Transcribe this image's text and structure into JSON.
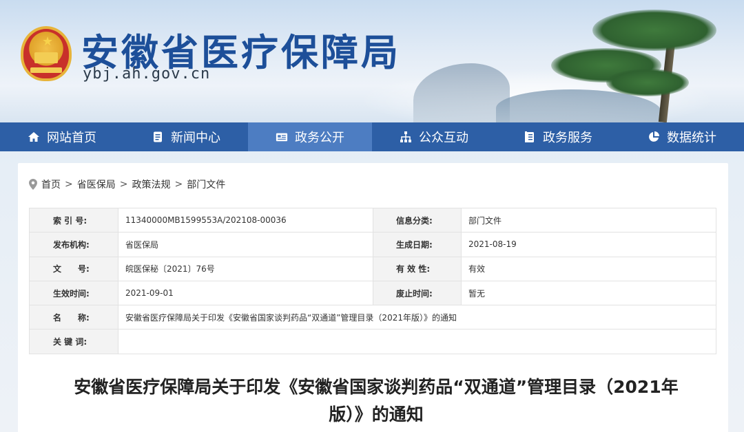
{
  "header": {
    "title": "安徽省医疗保障局",
    "url": "ybj.ah.gov.cn"
  },
  "nav": {
    "items": [
      {
        "label": "网站首页",
        "icon": "home-icon"
      },
      {
        "label": "新闻中心",
        "icon": "document-icon"
      },
      {
        "label": "政务公开",
        "icon": "card-icon",
        "active": true
      },
      {
        "label": "公众互动",
        "icon": "network-icon"
      },
      {
        "label": "政务服务",
        "icon": "clipboard-icon"
      },
      {
        "label": "数据统计",
        "icon": "pie-chart-icon"
      }
    ]
  },
  "breadcrumb": {
    "items": [
      "首页",
      "省医保局",
      "政策法规",
      "部门文件"
    ],
    "separator": ">"
  },
  "meta": {
    "index_label": "索 引 号:",
    "index_value": "11340000MB1599553A/202108-00036",
    "category_label": "信息分类:",
    "category_value": "部门文件",
    "publisher_label": "发布机构:",
    "publisher_value": "省医保局",
    "created_label": "生成日期:",
    "created_value": "2021-08-19",
    "docno_label": "文　　号:",
    "docno_value": "皖医保秘〔2021〕76号",
    "validity_label": "有 效 性:",
    "validity_value": "有效",
    "effective_label": "生效时间:",
    "effective_value": "2021-09-01",
    "expiry_label": "废止时间:",
    "expiry_value": "暂无",
    "name_label": "名　　称:",
    "name_value": "安徽省医疗保障局关于印发《安徽省国家谈判药品“双通道”管理目录（2021年版）》的通知",
    "keywords_label": "关 键 词:",
    "keywords_value": ""
  },
  "document": {
    "title_line1": "安徽省医疗保障局关于印发《安徽省国家谈判药品“双通道”管理目录（2021年",
    "title_line2": "版）》的通知"
  },
  "colors": {
    "nav_bg": "#2d5fa6",
    "nav_active": "#4d7dc2",
    "title_blue": "#1d4f99"
  }
}
